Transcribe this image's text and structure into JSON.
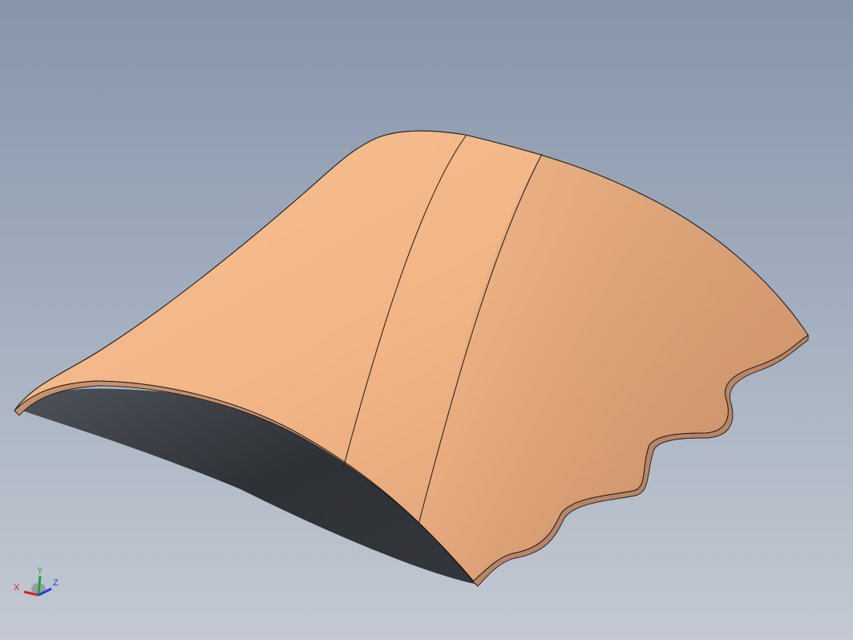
{
  "viewport": {
    "background_top": "#8795aa",
    "background_bottom": "#c4c9d2"
  },
  "model": {
    "name": "curved-sheet-with-wavy-edge",
    "face_color": "#f0b487",
    "edge_color": "#1a1a1a",
    "shadow_color": "#2c2f33"
  },
  "triad": {
    "x_label": "X",
    "y_label": "Y",
    "z_label": "Z",
    "x_color": "#d42222",
    "y_color": "#1fa33a",
    "z_color": "#2040d8"
  }
}
